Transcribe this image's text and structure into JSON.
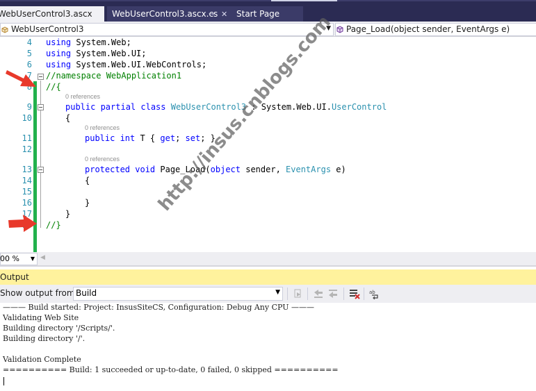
{
  "tabs": [
    {
      "label": "WebUserControl3.ascx",
      "active": true
    },
    {
      "label": "WebUserControl3.ascx.cs",
      "active": false,
      "pin": "⊸",
      "close": "✕"
    },
    {
      "label": "Start Page",
      "active": false
    }
  ],
  "navigation": {
    "class_dropdown": "WebUserControl3",
    "member_dropdown": "Page_Load(object sender, EventArgs e)"
  },
  "editor": {
    "line_numbers": [
      "4",
      "5",
      "6",
      "7",
      "8",
      "9",
      "10",
      "11",
      "12",
      "13",
      "14",
      "15",
      "16",
      "17",
      "18"
    ],
    "code": {
      "l4_kw": "using",
      "l4_rest": " System.Web;",
      "l5_kw": "using",
      "l5_rest": " System.Web.UI;",
      "l6_kw": "using",
      "l6_rest": " System.Web.UI.WebControls;",
      "l7": "//namespace WebApplication1",
      "l8": "//{",
      "l9_ref": "0 references",
      "l9_kw": "public partial class",
      "l9_type": "WebUserControl3",
      "l9_mid": " : System.Web.UI.",
      "l9_base": "UserControl",
      "l10": "{",
      "l11_ref": "0 references",
      "l11_kw": "public int",
      "l11_mid": " T { ",
      "l11_get": "get",
      "l11_semi": "; ",
      "l11_set": "set",
      "l11_end": "; }",
      "l13_ref": "0 references",
      "l13_kw": "protected void",
      "l13_mid": " Page_Load(",
      "l13_obj": "object",
      "l13_mid2": " sender, ",
      "l13_type": "EventArgs",
      "l13_end": " e)",
      "l14": "{",
      "l16": "}",
      "l17": "}",
      "l18": "//}"
    }
  },
  "zoom": {
    "value": "100 %"
  },
  "output": {
    "title": "Output",
    "show_from_label": "Show output from:",
    "source": "Build",
    "lines": [
      "——— Build started: Project: InsusSiteCS, Configuration: Debug Any CPU ———",
      "Validating Web Site",
      "Building directory '/Scripts/'.",
      "Building directory '/'.",
      "",
      "Validation Complete",
      "========== Build: 1 succeeded or up-to-date, 0 failed, 0 skipped =========="
    ]
  },
  "watermark": "http://insus.cnblogs.com",
  "colors": {
    "accent_green_bar": "#22b14c",
    "annotation_arrow": "#e8392b",
    "output_header": "#fff29d",
    "tab_strip": "#2b2b53"
  }
}
